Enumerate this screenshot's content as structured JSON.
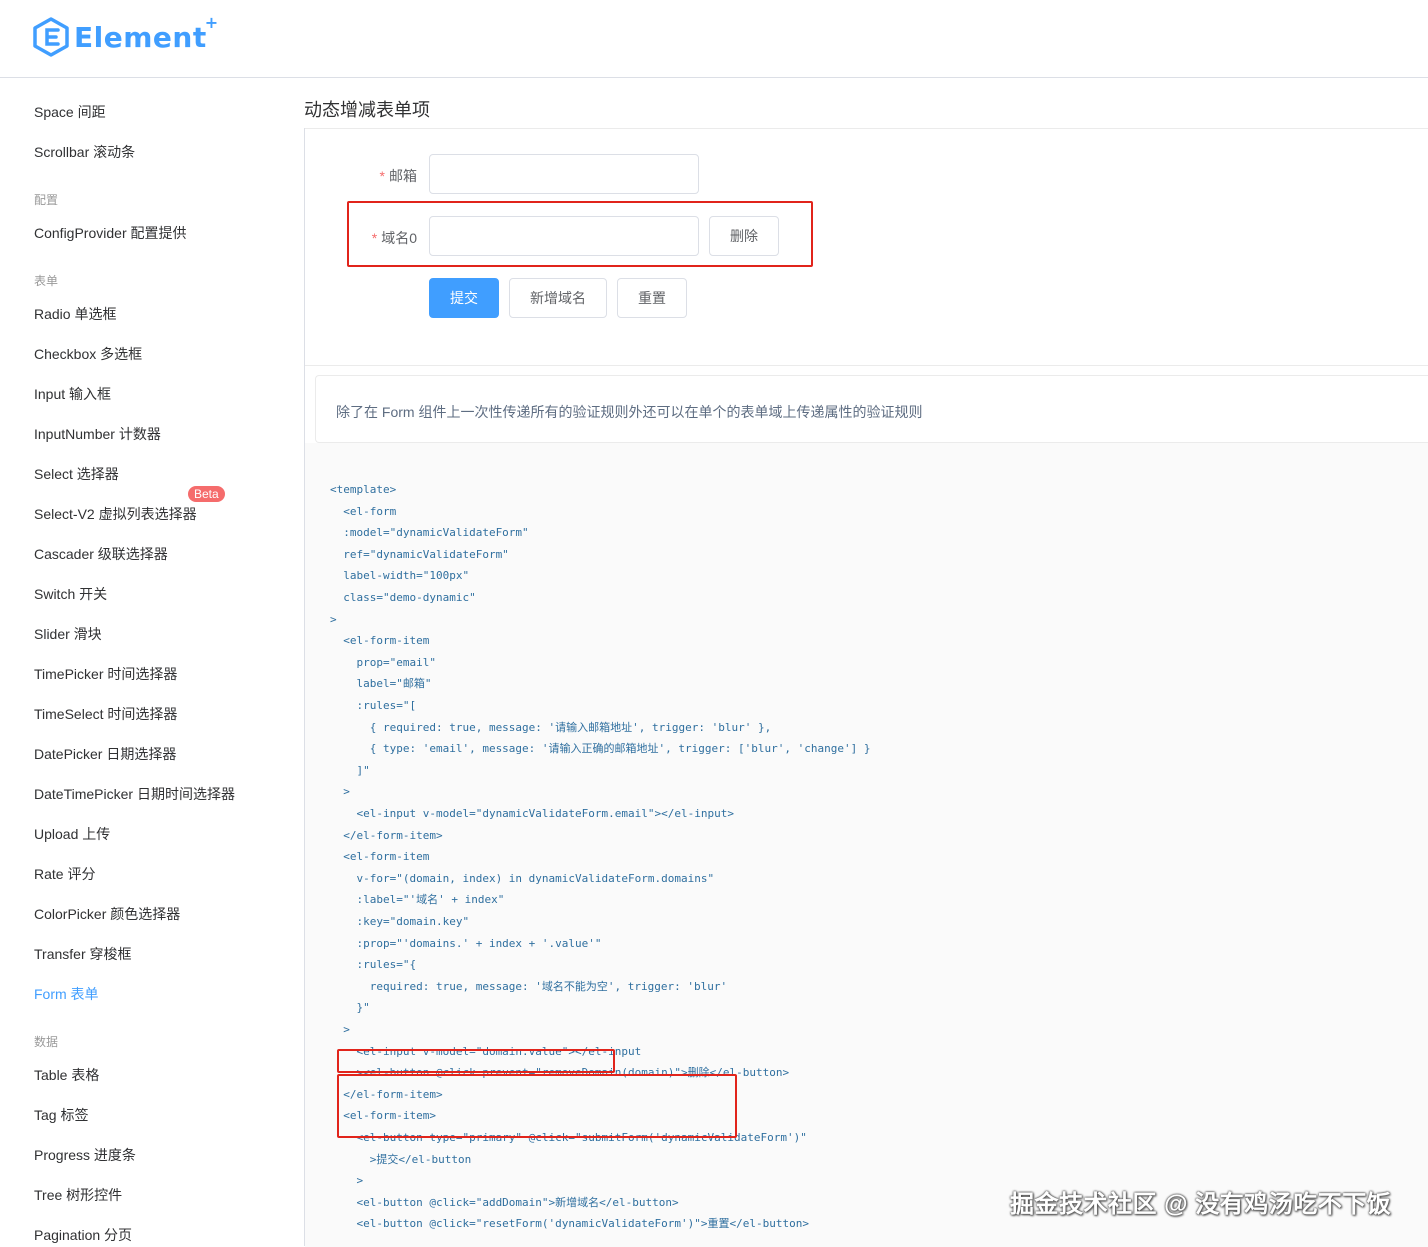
{
  "brand": {
    "name": "Element",
    "sup": "+"
  },
  "sidebar": {
    "items_top": [
      "Space 间距",
      "Scrollbar 滚动条"
    ],
    "group_config": "配置",
    "items_config": [
      "ConfigProvider 配置提供"
    ],
    "group_form": "表单",
    "items_form": [
      "Radio 单选框",
      "Checkbox 多选框",
      "Input 输入框",
      "InputNumber 计数器",
      "Select 选择器",
      "Select-V2 虚拟列表选择器",
      "Cascader 级联选择器",
      "Switch 开关",
      "Slider 滑块",
      "TimePicker 时间选择器",
      "TimeSelect 时间选择器",
      "DatePicker 日期选择器",
      "DateTimePicker 日期时间选择器",
      "Upload 上传",
      "Rate 评分",
      "ColorPicker 颜色选择器",
      "Transfer 穿梭框",
      "Form 表单"
    ],
    "beta_badge": "Beta",
    "group_data": "数据",
    "items_data": [
      "Table 表格",
      "Tag 标签",
      "Progress 进度条",
      "Tree 树形控件",
      "Pagination 分页"
    ],
    "active": "Form 表单"
  },
  "content": {
    "title": "动态增减表单项",
    "form": {
      "email_label": "邮箱",
      "domain_label": "域名0",
      "delete_button": "删除",
      "submit_button": "提交",
      "add_domain_button": "新增域名",
      "reset_button": "重置"
    },
    "description": "除了在 Form 组件上一次性传递所有的验证规则外还可以在单个的表单域上传递属性的验证规则",
    "code_lines": [
      "<template>",
      "  <el-form",
      "  :model=\"dynamicValidateForm\"",
      "  ref=\"dynamicValidateForm\"",
      "  label-width=\"100px\"",
      "  class=\"demo-dynamic\"",
      ">",
      "  <el-form-item",
      "    prop=\"email\"",
      "    label=\"邮箱\"",
      "    :rules=\"[",
      "      { required: true, message: '请输入邮箱地址', trigger: 'blur' },",
      "      { type: 'email', message: '请输入正确的邮箱地址', trigger: ['blur', 'change'] }",
      "    ]\"",
      "  >",
      "    <el-input v-model=\"dynamicValidateForm.email\"></el-input>",
      "  </el-form-item>",
      "  <el-form-item",
      "    v-for=\"(domain, index) in dynamicValidateForm.domains\"",
      "    :label=\"'域名' + index\"",
      "    :key=\"domain.key\"",
      "    :prop=\"'domains.' + index + '.value'\"",
      "    :rules=\"{",
      "      required: true, message: '域名不能为空', trigger: 'blur'",
      "    }\"",
      "  >",
      "    <el-input v-model=\"domain.value\"></el-input",
      "    ><el-button @click.prevent=\"removeDomain(domain)\">删除</el-button>",
      "  </el-form-item>",
      "  <el-form-item>",
      "    <el-button type=\"primary\" @click=\"submitForm('dynamicValidateForm')\"",
      "      >提交</el-button",
      "    >",
      "    <el-button @click=\"addDomain\">新增域名</el-button>",
      "    <el-button @click=\"resetForm('dynamicValidateForm')\">重置</el-button>"
    ]
  },
  "watermark": "掘金技术社区 @ 没有鸡汤吃不下饭",
  "colors": {
    "primary": "#409eff",
    "annotation_red": "#e1241b",
    "danger": "#f56c6c"
  }
}
